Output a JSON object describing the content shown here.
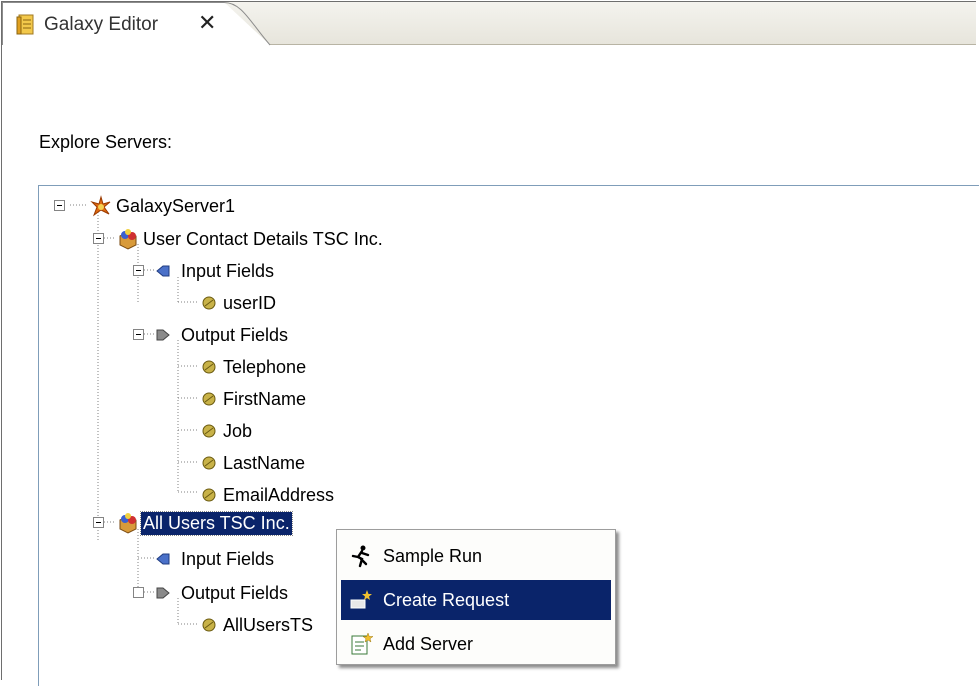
{
  "tab": {
    "title": "Galaxy Editor",
    "close_glyph": "✕",
    "icon": "editor-doc-icon"
  },
  "section_label": "Explore Servers:",
  "tree": {
    "root": {
      "label": "GalaxyServer1",
      "icon": "server-icon"
    },
    "services": [
      {
        "label": "User Contact Details TSC Inc.",
        "icon": "service-icon",
        "input_group": {
          "label": "Input Fields",
          "fields": [
            "userID"
          ]
        },
        "output_group": {
          "label": "Output Fields",
          "fields": [
            "Telephone",
            "FirstName",
            "Job",
            "LastName",
            "EmailAddress"
          ]
        }
      },
      {
        "label": "All Users TSC Inc.",
        "icon": "service-icon",
        "selected": true,
        "input_group": {
          "label": "Input Fields",
          "fields": []
        },
        "output_group": {
          "label": "Output Fields",
          "fields": [
            "AllUsersTS"
          ]
        }
      }
    ]
  },
  "context_menu": {
    "items": [
      {
        "label": "Sample Run",
        "icon": "runner-icon"
      },
      {
        "label": "Create Request",
        "icon": "create-request-icon",
        "highlighted": true
      },
      {
        "label": "Add Server",
        "icon": "add-server-icon"
      }
    ]
  },
  "colors": {
    "selection": "#0a246a",
    "tree_border": "#7f9db9"
  }
}
